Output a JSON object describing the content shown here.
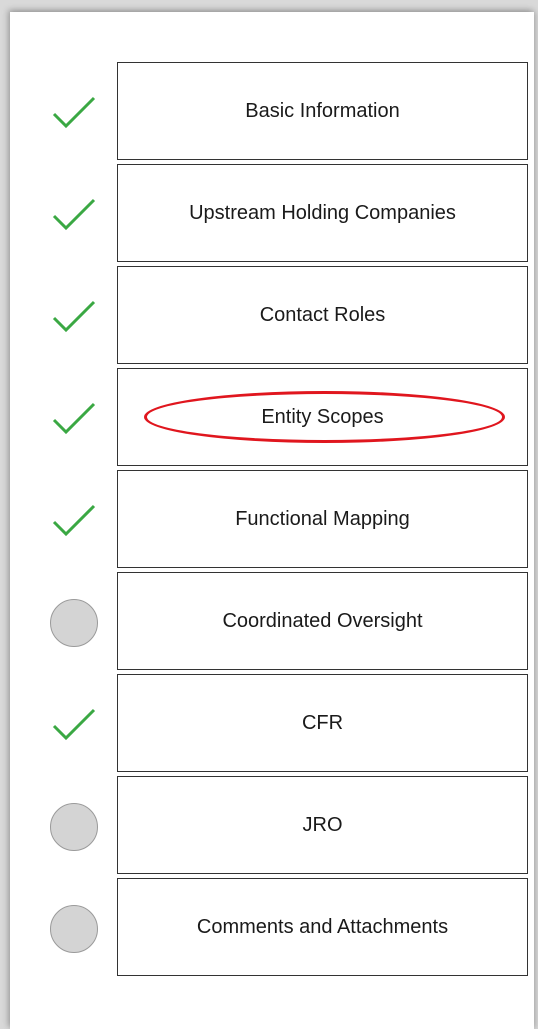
{
  "steps": [
    {
      "label": "Basic Information",
      "status": "complete"
    },
    {
      "label": "Upstream Holding Companies",
      "status": "complete"
    },
    {
      "label": "Contact Roles",
      "status": "complete"
    },
    {
      "label": "Entity Scopes",
      "status": "complete",
      "highlighted": true
    },
    {
      "label": "Functional Mapping",
      "status": "complete"
    },
    {
      "label": "Coordinated Oversight",
      "status": "pending"
    },
    {
      "label": "CFR",
      "status": "complete"
    },
    {
      "label": "JRO",
      "status": "pending"
    },
    {
      "label": "Comments and Attachments",
      "status": "pending"
    }
  ],
  "colors": {
    "check": "#3aa843",
    "pending": "#d4d4d4",
    "highlight": "#e0161e",
    "border": "#333333"
  },
  "icons": {
    "complete": "checkmark-icon",
    "pending": "pending-circle-icon"
  }
}
